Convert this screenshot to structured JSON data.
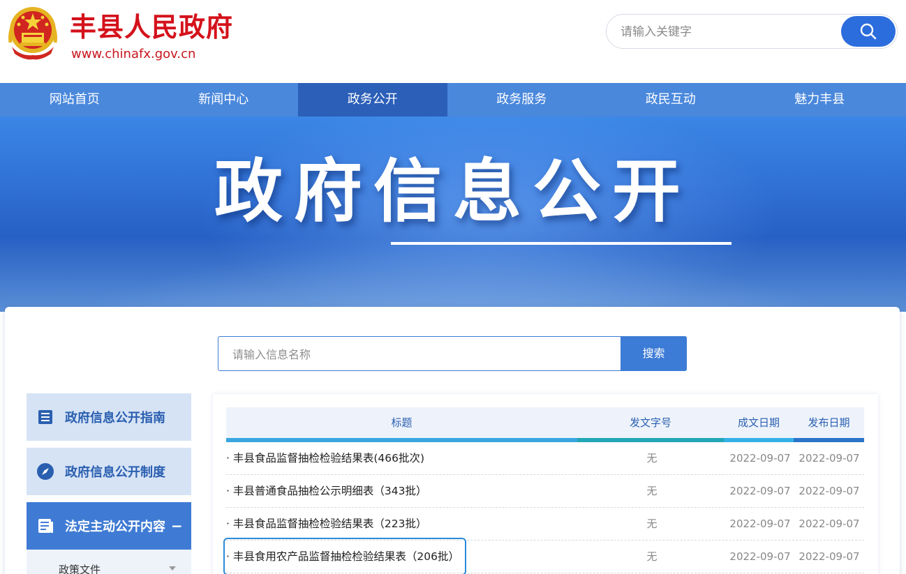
{
  "header": {
    "site_title": "丰县人民政府",
    "site_url": "www.chinafx.gov.cn",
    "search_placeholder": "请输入关键字"
  },
  "nav": {
    "items": [
      {
        "label": "网站首页",
        "active": false
      },
      {
        "label": "新闻中心",
        "active": false
      },
      {
        "label": "政务公开",
        "active": true
      },
      {
        "label": "政务服务",
        "active": false
      },
      {
        "label": "政民互动",
        "active": false
      },
      {
        "label": "魅力丰县",
        "active": false
      }
    ]
  },
  "banner": {
    "title": "政府信息公开"
  },
  "info_search": {
    "placeholder": "请输入信息名称",
    "button_label": "搜索"
  },
  "sidebar": {
    "items": [
      {
        "label": "政府信息公开指南",
        "icon": "list-document-icon"
      },
      {
        "label": "政府信息公开制度",
        "icon": "compass-icon"
      },
      {
        "label": "法定主动公开内容",
        "icon": "document-stack-icon",
        "toggle": "−"
      }
    ],
    "sub_items": [
      {
        "label": "政策文件"
      }
    ]
  },
  "table": {
    "headers": {
      "title": "标题",
      "doc_number": "发文字号",
      "created_date": "成文日期",
      "published_date": "发布日期"
    },
    "rows": [
      {
        "title": "· 丰县食品监督抽检检验结果表(466批次)",
        "doc_number": "无",
        "created_date": "2022-09-07",
        "published_date": "2022-09-07"
      },
      {
        "title": "· 丰县普通食品抽检公示明细表（343批）",
        "doc_number": "无",
        "created_date": "2022-09-07",
        "published_date": "2022-09-07"
      },
      {
        "title": "· 丰县食品监督抽检检验结果表（223批）",
        "doc_number": "无",
        "created_date": "2022-09-07",
        "published_date": "2022-09-07"
      },
      {
        "title": "· 丰县食用农产品监督抽检检验结果表（206批）",
        "doc_number": "无",
        "created_date": "2022-09-07",
        "published_date": "2022-09-07"
      }
    ]
  },
  "colors": {
    "brand_red": "#d4121b",
    "nav_blue": "#4a88dc",
    "nav_active": "#2b5fb8",
    "accent_blue": "#3c7bd6"
  }
}
